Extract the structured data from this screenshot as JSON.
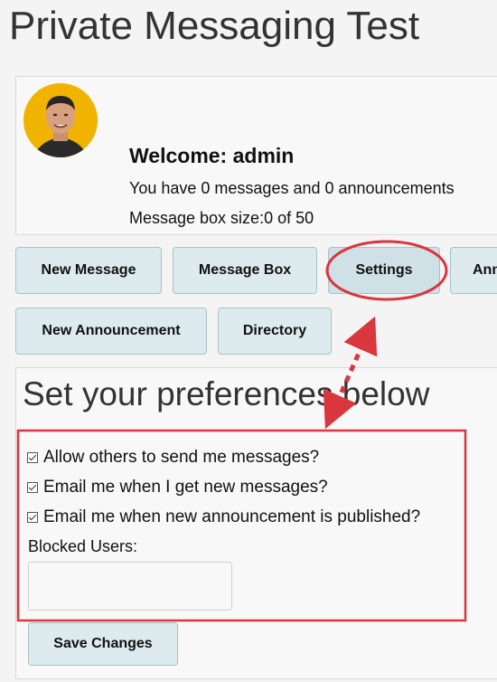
{
  "app": {
    "title": "Private Messaging Test"
  },
  "user": {
    "welcome": "Welcome: admin",
    "messages_text": "You have 0 messages and 0 announcements",
    "box_size_text": "Message box size:0 of 50"
  },
  "nav": {
    "new_message": "New Message",
    "message_box": "Message Box",
    "settings": "Settings",
    "announcements_partial": "Ann",
    "new_announcement": "New Announcement",
    "directory": "Directory",
    "active": "Settings"
  },
  "settings": {
    "heading": "Set your preferences below",
    "prefs": [
      {
        "label": "Allow others to send me messages?",
        "checked": true
      },
      {
        "label": "Email me when I get new messages?",
        "checked": true
      },
      {
        "label": "Email me when new announcement is published?",
        "checked": true
      }
    ],
    "blocked_label": "Blocked Users:",
    "blocked_value": "",
    "save_label": "Save Changes"
  },
  "colors": {
    "button_bg": "#deebee",
    "button_border": "#a9c1c7",
    "annotation_red": "#d9363e",
    "avatar_bg": "#f0b400"
  },
  "icons": [
    "avatar-photo",
    "checkbox-checked-icon",
    "dotted-arrow"
  ]
}
